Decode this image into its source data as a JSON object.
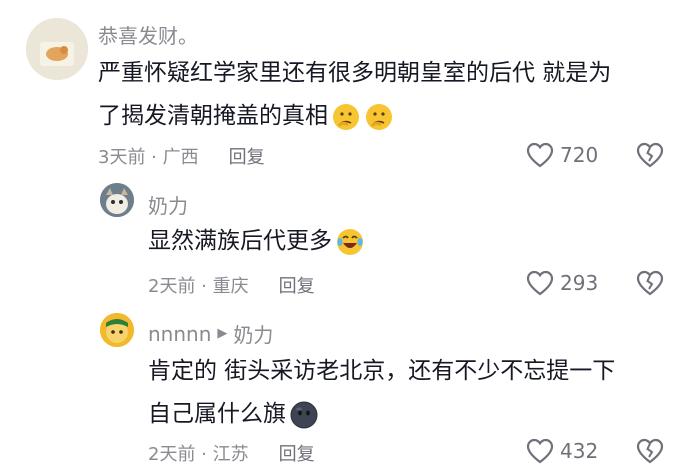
{
  "comments": [
    {
      "username": "恭喜发财。",
      "lines": [
        "严重怀疑红学家里还有很多明朝皇室的后代 就是为",
        "了揭发清朝掩盖的真相"
      ],
      "time_location": "3天前 · 广西",
      "reply_label": "回复",
      "likes": "720",
      "emojis": [
        "thinking-face-emoji",
        "thinking-face-emoji"
      ]
    },
    {
      "username": "奶力",
      "lines": [
        "显然满族后代更多"
      ],
      "time_location": "2天前 · 重庆",
      "reply_label": "回复",
      "likes": "293",
      "emojis": [
        "laughing-tears-emoji"
      ]
    },
    {
      "username": "nnnnn",
      "reply_to": "奶力",
      "lines": [
        "肯定的 街头采访老北京，还有不少不忘提一下",
        "自己属什么旗"
      ],
      "time_location": "2天前 · 江苏",
      "reply_label": "回复",
      "likes": "432",
      "emojis": [
        "dark-face-emoji"
      ]
    }
  ]
}
